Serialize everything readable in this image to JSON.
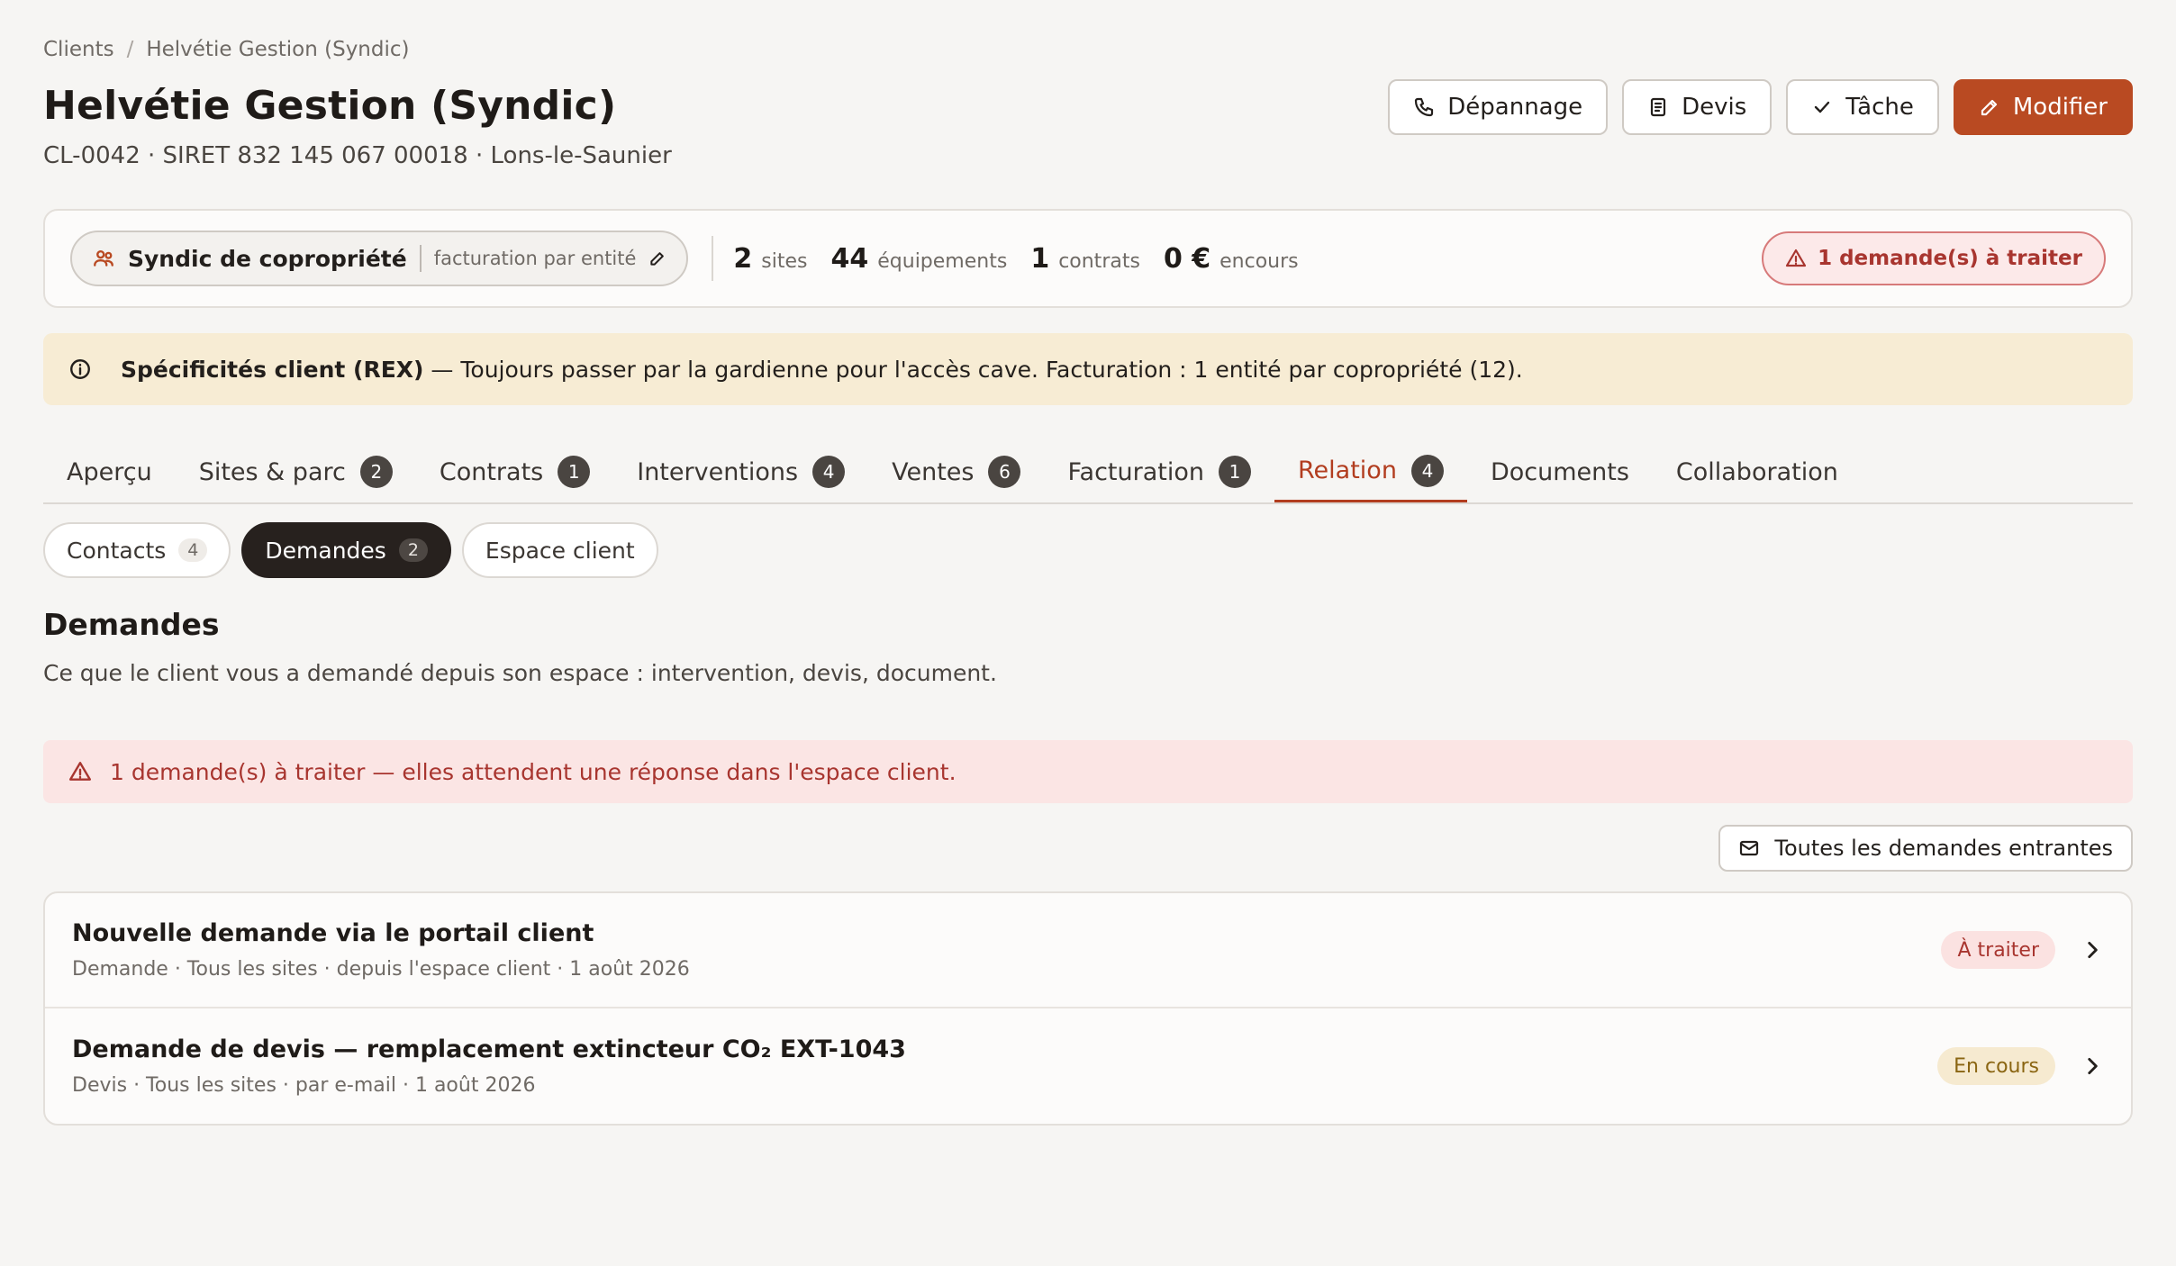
{
  "breadcrumb": {
    "root": "Clients",
    "separator": "/",
    "current": "Helvétie Gestion (Syndic)"
  },
  "header": {
    "title": "Helvétie Gestion (Syndic)",
    "subtitle": "CL-0042 · SIRET 832 145 067 00018 · Lons-le-Saunier"
  },
  "actions": {
    "depannage": "Dépannage",
    "devis": "Devis",
    "tache": "Tâche",
    "modifier": "Modifier"
  },
  "summary": {
    "type_label": "Syndic de copropriété",
    "billing_mode": "facturation par entité",
    "stats": [
      {
        "value": "2",
        "label": "sites"
      },
      {
        "value": "44",
        "label": "équipements"
      },
      {
        "value": "1",
        "label": "contrats"
      },
      {
        "value": "0 €",
        "label": "encours"
      }
    ],
    "alert": "1 demande(s) à traiter"
  },
  "rex": {
    "label": "Spécificités client (REX)",
    "text": " — Toujours passer par la gardienne pour l'accès cave. Facturation : 1 entité par copropriété (12)."
  },
  "tabs": [
    {
      "label": "Aperçu",
      "count": null
    },
    {
      "label": "Sites & parc",
      "count": "2"
    },
    {
      "label": "Contrats",
      "count": "1"
    },
    {
      "label": "Interventions",
      "count": "4"
    },
    {
      "label": "Ventes",
      "count": "6"
    },
    {
      "label": "Facturation",
      "count": "1"
    },
    {
      "label": "Relation",
      "count": "4"
    },
    {
      "label": "Documents",
      "count": null
    },
    {
      "label": "Collaboration",
      "count": null
    }
  ],
  "subtabs": [
    {
      "label": "Contacts",
      "count": "4"
    },
    {
      "label": "Demandes",
      "count": "2"
    },
    {
      "label": "Espace client",
      "count": null
    }
  ],
  "section": {
    "title": "Demandes",
    "description": "Ce que le client vous a demandé depuis son espace : intervention, devis, document."
  },
  "warning": "1 demande(s) à traiter — elles attendent une réponse dans l'espace client.",
  "all_requests_button": "Toutes les demandes entrantes",
  "requests": [
    {
      "title": "Nouvelle demande via le portail client",
      "meta": "Demande · Tous les sites · depuis l'espace client · 1 août 2026",
      "status": "À traiter"
    },
    {
      "title": "Demande de devis — remplacement extincteur CO₂ EXT-1043",
      "meta": "Devis · Tous les sites · par e-mail · 1 août 2026",
      "status": "En cours"
    }
  ],
  "colors": {
    "accent": "#b94a22",
    "active_tab": "#b23d1f",
    "alert_red": "#a8352f",
    "rex_bg": "#f7ecd4",
    "dark_pill": "#27211e"
  }
}
